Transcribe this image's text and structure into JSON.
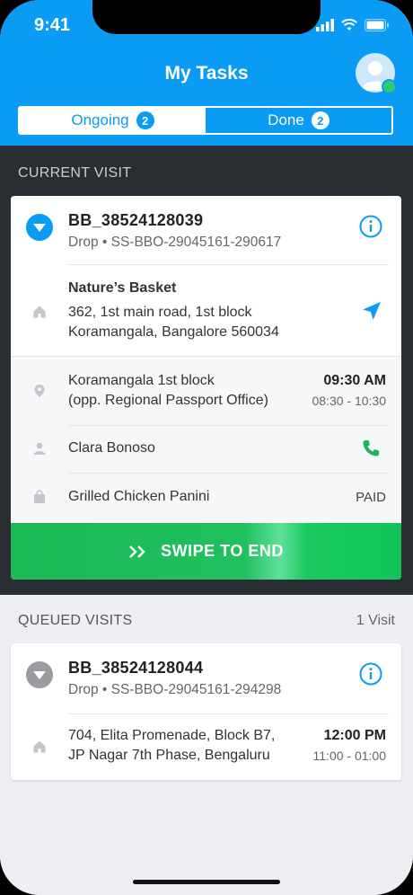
{
  "status_bar": {
    "time": "9:41"
  },
  "header": {
    "title": "My Tasks"
  },
  "tabs": [
    {
      "label": "Ongoing",
      "count": "2"
    },
    {
      "label": "Done",
      "count": "2"
    }
  ],
  "current_visit": {
    "section_label": "CURRENT VISIT",
    "order_id": "BB_38524128039",
    "order_sub": "Drop • SS-BBO-29045161-290617",
    "store_name": "Nature’s Basket",
    "store_address_line1": "362, 1st main road, 1st block",
    "store_address_line2": "Koramangala, Bangalore 560034",
    "drop_location_line1": "Koramangala 1st block",
    "drop_location_line2": "(opp. Regional Passport Office)",
    "drop_time": "09:30 AM",
    "drop_window": "08:30 - 10:30",
    "customer_name": "Clara Bonoso",
    "item": "Grilled Chicken Panini",
    "payment_status": "PAID",
    "swipe_label": "SWIPE TO END"
  },
  "queued_visits": {
    "section_label": "QUEUED VISITS",
    "count_label": "1 Visit",
    "items": [
      {
        "order_id": "BB_38524128044",
        "order_sub": "Drop • SS-BBO-29045161-294298",
        "address_line1": "704, Elita Promenade, Block B7,",
        "address_line2": "JP Nagar 7th Phase, Bengaluru",
        "time": "12:00 PM",
        "window": "11:00 - 01:00"
      }
    ]
  },
  "colors": {
    "primary": "#0a9cf5",
    "success": "#1cb957",
    "dark_bg": "#2a2d31"
  }
}
